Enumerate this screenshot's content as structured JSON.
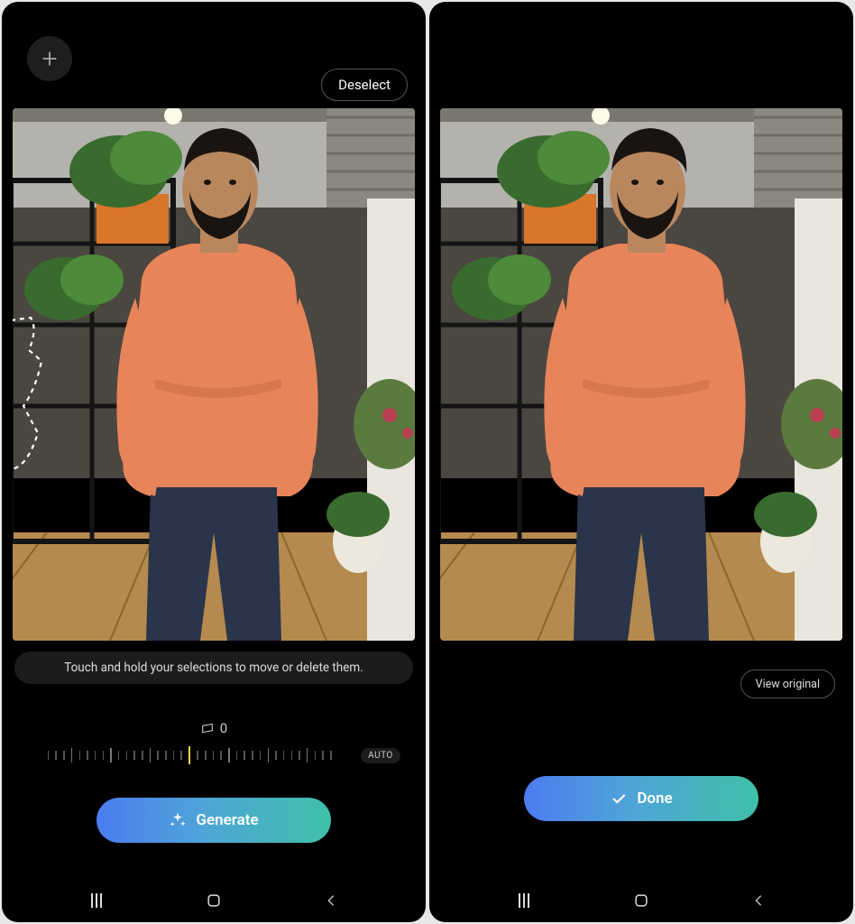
{
  "left": {
    "deselect_label": "Deselect",
    "hint_text": "Touch and hold your selections to move or delete them.",
    "slider_value": "0",
    "auto_label": "AUTO",
    "generate_label": "Generate",
    "icons": {
      "add": "plus-icon",
      "slider_indicator": "straighten-icon",
      "generate": "sparkle-icon"
    }
  },
  "right": {
    "view_original_label": "View original",
    "done_label": "Done",
    "icons": {
      "done": "check-icon"
    }
  },
  "nav": {
    "recents": "recents-button",
    "home": "home-button",
    "back": "back-button"
  },
  "photo": {
    "subject": "person-in-orange-sweater",
    "background": "office-interior-with-plants",
    "colors": {
      "sweater": "#e8845a",
      "pants": "#2a344a",
      "skin": "#b9875e",
      "hair": "#1a1410",
      "ceiling": "#b4b2ad",
      "floor": "#b58a4e",
      "plant": "#3a6b2e",
      "shelf": "#1a1a1a",
      "planter_orange": "#d9762a",
      "wall_light": "#e9e6de"
    }
  }
}
